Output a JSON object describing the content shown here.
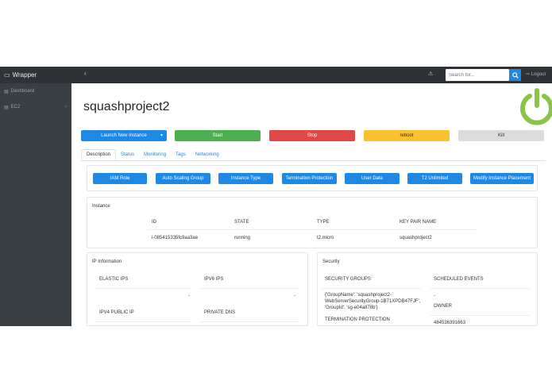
{
  "sidebar": {
    "brand": "Wrapper",
    "items": [
      {
        "label": "Dashboard"
      },
      {
        "label": "EC2"
      }
    ]
  },
  "topbar": {
    "search_placeholder": "Search for...",
    "logout": "Logout"
  },
  "page": {
    "title": "squashproject2"
  },
  "buttons": {
    "launch": "Launch New Instance",
    "start": "Start",
    "stop": "Stop",
    "reboot": "reboot",
    "kill": "Kill"
  },
  "tabs": [
    "Description",
    "Status",
    "Monitoring",
    "Tags",
    "Networking"
  ],
  "actions": [
    "IAM Role",
    "Auto Scaling Group",
    "Instance Type",
    "Termination Protection",
    "User Data",
    "T2 Unlimited",
    "Modify Instance Placement"
  ],
  "instance": {
    "header": "Instance",
    "columns": [
      "ID",
      "STATE",
      "TYPE",
      "KEY PAIR NAME"
    ],
    "values": [
      "i-085415335fc9aa3ae",
      "running",
      "t2.micro",
      "squashproject2"
    ]
  },
  "ip_info": {
    "header": "IP Information",
    "elastic_ips_label": "ELASTIC IPS",
    "elastic_ips_value": "-",
    "ipv6_label": "IPV6 IPS",
    "ipv6_value": "-",
    "ipv4_public_label": "IPV4 PUBLIC IP",
    "private_dns_label": "PRIVATE DNS"
  },
  "security": {
    "header": "Security",
    "groups_label": "SECURITY GROUPS",
    "groups_value_1": "{'GroupName': 'squashproject2-",
    "groups_value_2": "WebServerSecurityGroup-1B71XPDB47FJF',",
    "groups_value_3": "'GroupId': 'sg-e04a878b'}",
    "scheduled_label": "SCHEDULED EVENTS",
    "scheduled_value": "-",
    "owner_label": "OWNER",
    "owner_value": "484536391663",
    "termination_label": "TERMINATION PROTECTION"
  },
  "colors": {
    "primary": "#1e88e5",
    "success": "#4caf50",
    "danger": "#e04848",
    "warning": "#fbc02d",
    "sidebar": "#3a3f44",
    "logo": "#8bc34a"
  }
}
